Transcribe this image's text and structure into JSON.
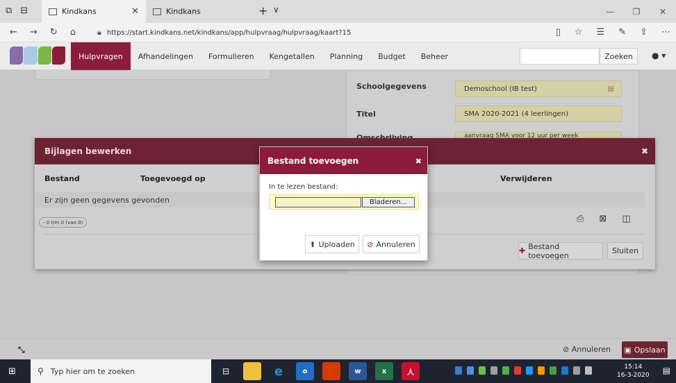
{
  "browser": {
    "tabs": [
      {
        "title": "Kindkans",
        "active": true
      },
      {
        "title": "Kindkans",
        "active": false
      }
    ],
    "url": "https://start.kindkans.net/kindkans/app/hulpvraag/hulpvraag/kaart?15"
  },
  "nav": {
    "items": [
      "Hulpvragen",
      "Afhandelingen",
      "Formulieren",
      "Kengetallen",
      "Planning",
      "Budget",
      "Beheer"
    ],
    "active": "Hulpvragen",
    "search_button": "Zoeken",
    "logo_colors": [
      "#8a6aa8",
      "#a9c9e6",
      "#7ab648",
      "#8c1c3a"
    ]
  },
  "form": {
    "schoolgegevens_label": "Schoolgegevens",
    "schoolgegevens_value": "Demoschool (IB test)",
    "titel_label": "Titel",
    "titel_value": "SMA 2020-2021 (4 leerlingen)",
    "omschrijving_label": "Omschrijving",
    "omschrijving_value": "aanvraag SMA voor 12 uur per week"
  },
  "bijlagen": {
    "title": "Bijlagen bewerken",
    "columns": {
      "bestand": "Bestand",
      "toegevoegd": "Toegevoegd op",
      "verwijderen": "Verwijderen"
    },
    "empty": "Er zijn geen gegevens gevonden",
    "pager": "- 0 t/m 0 (van 0)",
    "add_button": "Bestand toevoegen",
    "close_button": "Sluiten"
  },
  "bestand_modal": {
    "title": "Bestand toevoegen",
    "file_label": "In te lezen bestand:",
    "browse_button": "Bladeren...",
    "upload_button": "Uploaden",
    "cancel_button": "Annuleren"
  },
  "footer": {
    "cancel": "Annuleren",
    "save": "Opslaan"
  },
  "taskbar": {
    "search_placeholder": "Typ hier om te zoeken",
    "time": "15:14",
    "date": "16-3-2020"
  },
  "colors": {
    "accent": "#8c1c3a"
  }
}
